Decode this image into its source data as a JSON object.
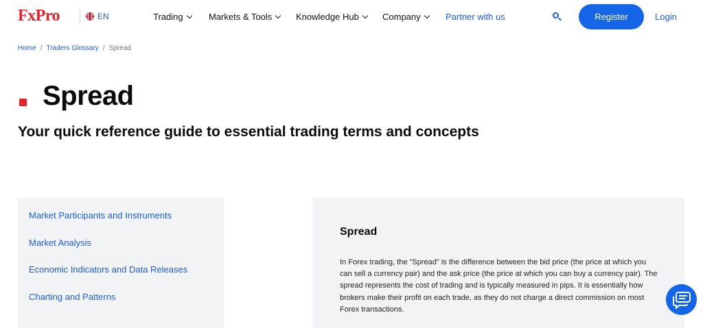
{
  "header": {
    "logo": "FxPro",
    "language": "EN",
    "nav": [
      {
        "label": "Trading",
        "has_dropdown": true
      },
      {
        "label": "Markets & Tools",
        "has_dropdown": true
      },
      {
        "label": "Knowledge Hub",
        "has_dropdown": true
      },
      {
        "label": "Company",
        "has_dropdown": true
      },
      {
        "label": "Partner with us",
        "has_dropdown": false
      }
    ],
    "search_icon": "search-icon",
    "register_label": "Register",
    "login_label": "Login"
  },
  "breadcrumb": {
    "items": [
      "Home",
      "Traders Glossary",
      "Spread"
    ],
    "separator": "/"
  },
  "page": {
    "title": "Spread",
    "subtitle": "Your quick reference guide to essential trading terms and concepts"
  },
  "sidebar": {
    "items": [
      {
        "label": "Market Participants and Instruments"
      },
      {
        "label": "Market Analysis"
      },
      {
        "label": "Economic Indicators and Data Releases"
      },
      {
        "label": "Charting and Patterns"
      }
    ]
  },
  "content": {
    "title": "Spread",
    "body": "In Forex trading, the \"Spread\" is the difference between the bid price (the price at which you can sell a currency pair) and the ask price (the price at which you can buy a currency pair). The spread represents the cost of trading and is typically measured in pips. It is essentially how brokers make their profit on each trade, as they do not charge a direct commission on most Forex transactions."
  },
  "chat": {
    "icon": "chat-icon"
  },
  "colors": {
    "brand_red": "#e3242b",
    "link_blue": "#1c5be0",
    "button_blue": "#1565e8",
    "panel_gray": "#f2f3f5"
  }
}
